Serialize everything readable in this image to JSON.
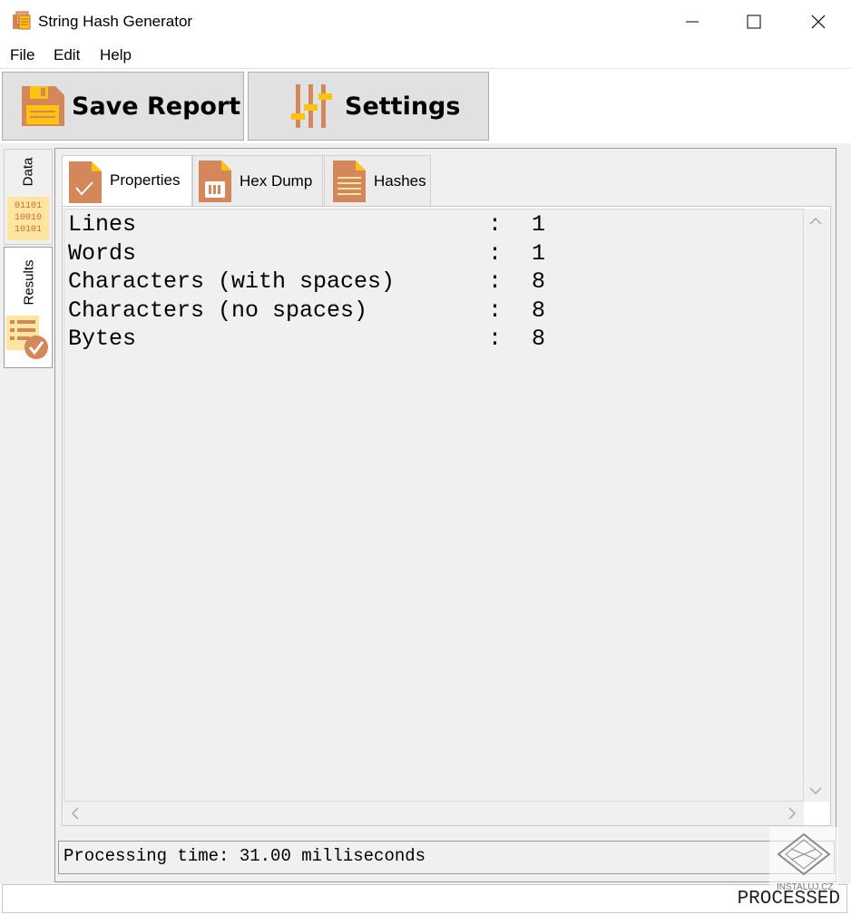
{
  "window": {
    "title": "String Hash Generator",
    "minimize_icon": "minimize-icon",
    "maximize_icon": "maximize-icon",
    "close_icon": "close-icon"
  },
  "menu": [
    "File",
    "Edit",
    "Help"
  ],
  "toolbar": {
    "save_report": "Save Report",
    "settings": "Settings"
  },
  "side_tabs": {
    "data": "Data",
    "data_icon_text": [
      "01101",
      "10010",
      "10101"
    ],
    "results": "Results"
  },
  "tabs": [
    "Properties",
    "Hex Dump",
    "Hashes"
  ],
  "active_tab": "Properties",
  "properties": [
    {
      "label": "Lines",
      "colon": ":",
      "value": "1"
    },
    {
      "label": "Words",
      "colon": ":",
      "value": "1"
    },
    {
      "label": "Characters (with spaces)",
      "colon": ":",
      "value": "8"
    },
    {
      "label": "Characters (no spaces)",
      "colon": ":",
      "value": "8"
    },
    {
      "label": "Bytes",
      "colon": ":",
      "value": "8"
    }
  ],
  "processing_status": "Processing time: 31.00 milliseconds",
  "status_bar": "PROCESSED",
  "watermark_text": "INSTALUJ.CZ",
  "colors": {
    "accent": "#d4875a",
    "accent_dark": "#b96b42",
    "yellow": "#ffc20e",
    "background": "#f0f0f0"
  }
}
